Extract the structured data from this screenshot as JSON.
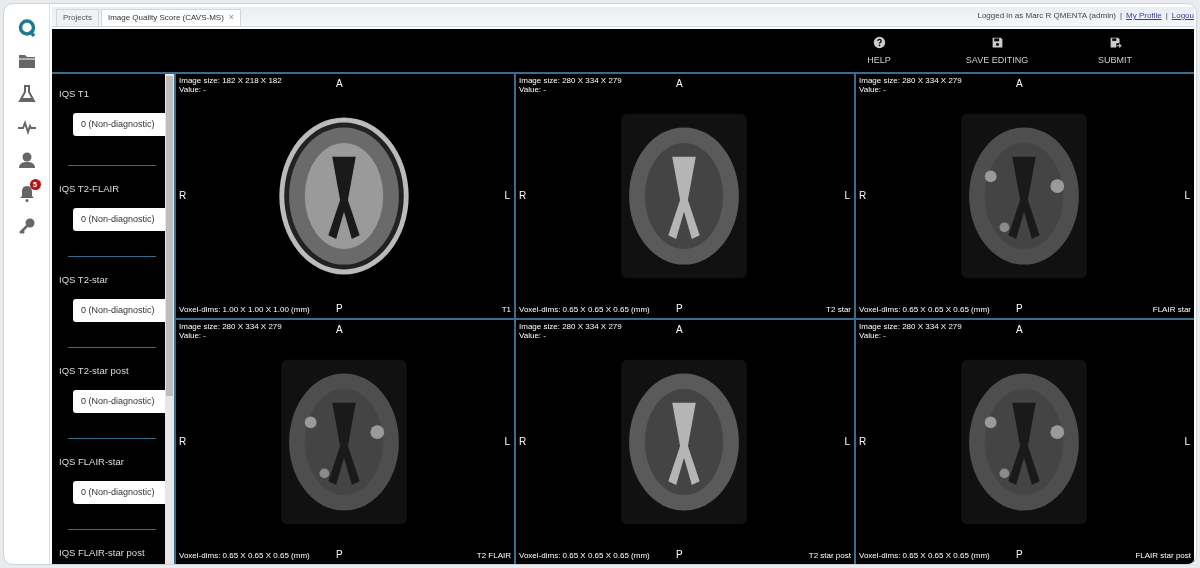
{
  "tabs": [
    {
      "label": "Projects",
      "selected": false,
      "closable": false
    },
    {
      "label": "Image Quality Score (CAVS-MS)",
      "selected": true,
      "closable": true
    }
  ],
  "close_glyph": "×",
  "user_bar": [
    "Logged in as  Marc R QMENTA (admin)",
    "|",
    "My Profile",
    "|",
    "Logou"
  ],
  "user_bar_links": [
    false,
    false,
    true,
    false,
    true
  ],
  "nav": [
    {
      "kind": "logo",
      "selected": false
    },
    {
      "kind": "folder",
      "selected": false
    },
    {
      "kind": "flask",
      "selected": false
    },
    {
      "kind": "pulse",
      "selected": false
    },
    {
      "kind": "user",
      "selected": false
    },
    {
      "kind": "bell",
      "selected": false,
      "badge": "5"
    },
    {
      "kind": "key",
      "selected": false
    }
  ],
  "toolbar": [
    {
      "kind": "help",
      "label": "HELP"
    },
    {
      "kind": "save",
      "label": "SAVE EDITING"
    },
    {
      "kind": "submit",
      "label": "SUBMIT"
    }
  ],
  "scores": [
    {
      "label": "IQS T1",
      "value": "0 (Non-diagnostic)"
    },
    {
      "label": "IQS T2-FLAIR",
      "value": "0 (Non-diagnostic)"
    },
    {
      "label": "IQS T2-star",
      "value": "0 (Non-diagnostic)"
    },
    {
      "label": "IQS T2-star post",
      "value": "0 (Non-diagnostic)"
    },
    {
      "label": "IQS FLAIR-star",
      "value": "0 (Non-diagnostic)"
    },
    {
      "label": "IQS FLAIR-star post"
    }
  ],
  "viewers": [
    {
      "image_size": "Image size: 182 X 218 X 182",
      "value": "Value: -",
      "voxel_dims": "Voxel-dims: 1.00 X 1.00 X 1.00 (mm)",
      "sequence": "T1",
      "orientation": [
        "A",
        "R",
        "L",
        "P"
      ],
      "kind": "t1"
    },
    {
      "image_size": "Image size: 280 X 334 X 279",
      "value": "Value: -",
      "voxel_dims": "Voxel-dims: 0.65 X 0.65 X 0.65 (mm)",
      "sequence": "T2 star",
      "orientation": [
        "A",
        "R",
        "L",
        "P"
      ],
      "kind": "t2"
    },
    {
      "image_size": "Image size: 280 X 334 X 279",
      "value": "Value: -",
      "voxel_dims": "Voxel-dims: 0.65 X 0.65 X 0.65 (mm)",
      "sequence": "FLAIR star",
      "orientation": [
        "A",
        "R",
        "L",
        "P"
      ],
      "kind": "flair"
    },
    {
      "image_size": "Image size: 280 X 334 X 279",
      "value": "Value: -",
      "voxel_dims": "Voxel-dims: 0.65 X 0.65 X 0.65 (mm)",
      "sequence": "T2 FLAIR",
      "orientation": [
        "A",
        "R",
        "L",
        "P"
      ],
      "kind": "flair"
    },
    {
      "image_size": "Image size: 280 X 334 X 279",
      "value": "Value: -",
      "voxel_dims": "Voxel-dims: 0.65 X 0.65 X 0.65 (mm)",
      "sequence": "T2 star post",
      "orientation": [
        "A",
        "R",
        "L",
        "P"
      ],
      "kind": "t2"
    },
    {
      "image_size": "Image size: 280 X 334 X 279",
      "value": "Value: -",
      "voxel_dims": "Voxel-dims: 0.65 X 0.65 X 0.65 (mm)",
      "sequence": "FLAIR star post",
      "orientation": [
        "A",
        "R",
        "L",
        "P"
      ],
      "kind": "flair"
    }
  ]
}
